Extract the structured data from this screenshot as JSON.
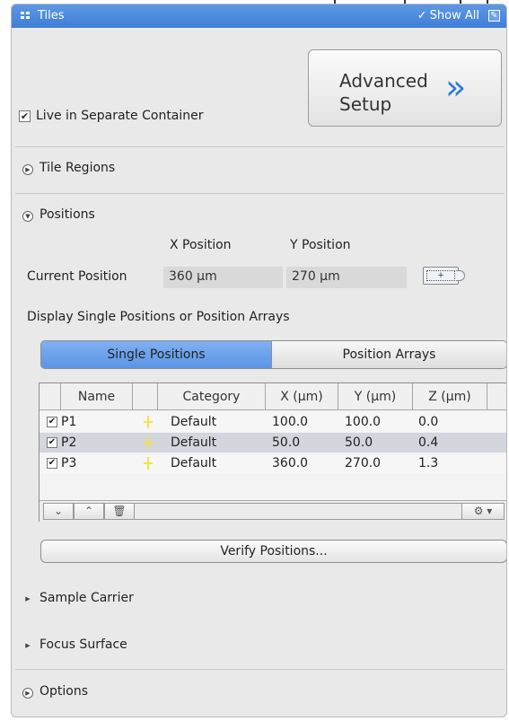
{
  "window": {
    "title": "Tiles",
    "show_all_check": "✓",
    "show_all_label": "Show All"
  },
  "setup": {
    "live_checkbox_mark": "✔",
    "live_label": "Live in Separate Container",
    "advanced_line1": "Advanced",
    "advanced_line2": "Setup",
    "advanced_chevron": "»"
  },
  "sections": {
    "tile_regions": "Tile Regions",
    "positions": "Positions",
    "sample_carrier": "Sample Carrier",
    "focus_surface": "Focus Surface",
    "options": "Options"
  },
  "positions": {
    "x_header": "X Position",
    "y_header": "Y Position",
    "current_label": "Current Position",
    "x_value": "360 μm",
    "y_value": "270 μm",
    "set_position_glyph": "+",
    "display_label": "Display Single Positions or Position Arrays",
    "mode_single": "Single Positions",
    "mode_arrays": "Position Arrays",
    "active_mode": "Single Positions",
    "columns": [
      "Name",
      "",
      "Category",
      "X (μm)",
      "Y (μm)",
      "Z (μm)"
    ],
    "rows": [
      {
        "checked": "✔",
        "name": "P1",
        "category": "Default",
        "x": "100.0",
        "y": "100.0",
        "z": "0.0"
      },
      {
        "checked": "✔",
        "name": "P2",
        "category": "Default",
        "x": "50.0",
        "y": "50.0",
        "z": "0.4"
      },
      {
        "checked": "✔",
        "name": "P3",
        "category": "Default",
        "x": "360.0",
        "y": "270.0",
        "z": "1.3"
      }
    ],
    "toolbar": {
      "move_down": "⌄",
      "move_up": "⌃",
      "delete": "🗑",
      "options": "⚙ ▾"
    },
    "verify_label": "Verify Positions..."
  },
  "icons": {
    "title": "grid-icon",
    "show_all": "checkmark-icon",
    "edit": "edit-icon",
    "advanced": "double-chevron-right-icon",
    "expand": "expand-arrow-icon",
    "collapse": "collapse-arrow-icon"
  },
  "colors": {
    "titlebar": "#4a88dc",
    "active_segment": "#6ea3ec",
    "accent_chevron": "#2d7be0",
    "position_marker": "#f4e34a"
  }
}
